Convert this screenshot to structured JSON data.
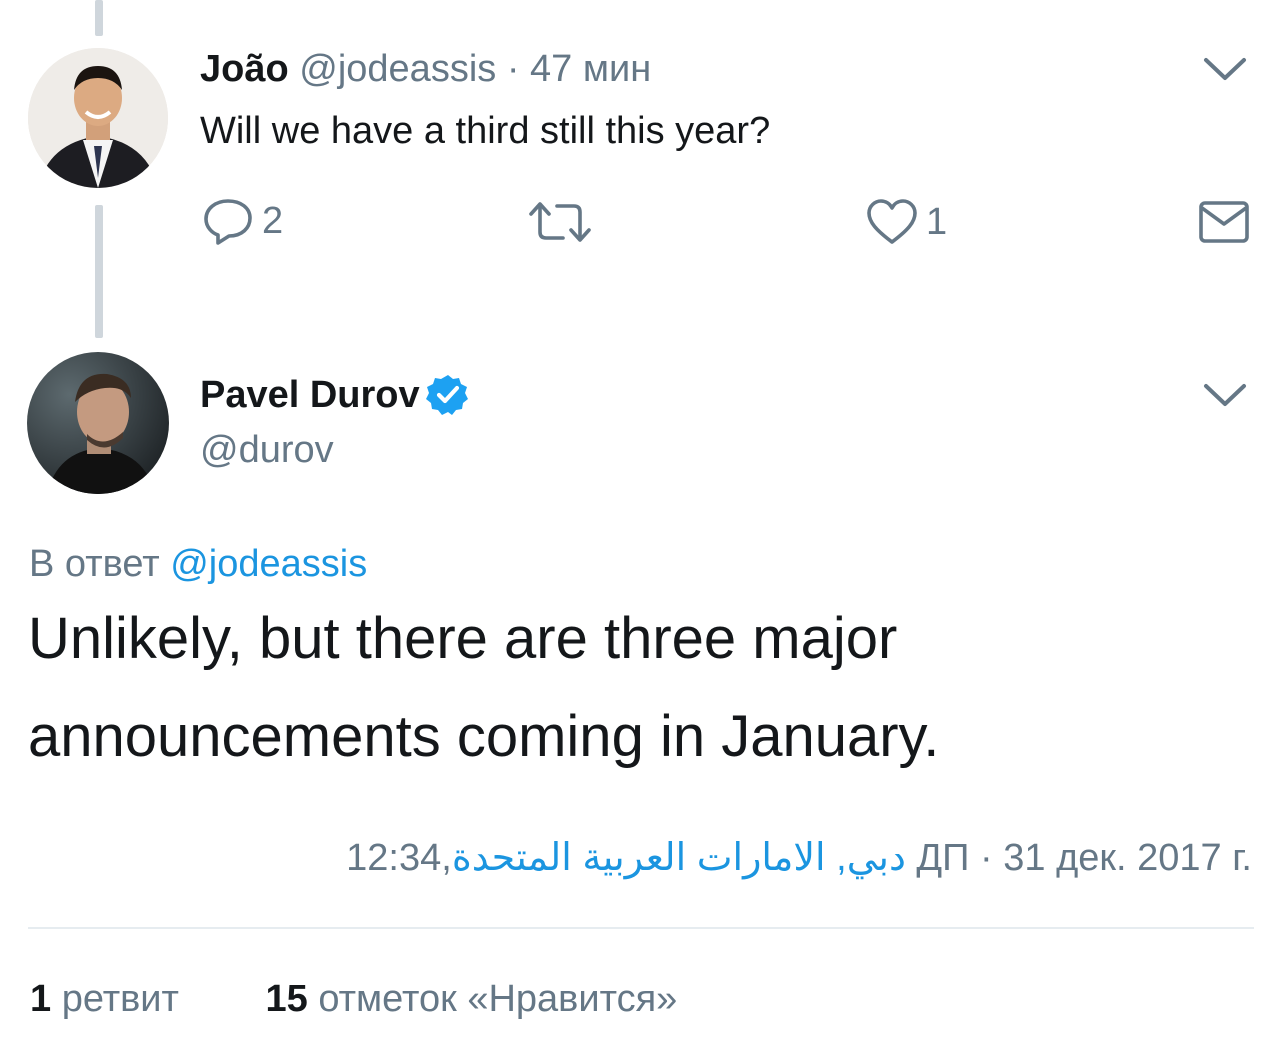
{
  "reply_tweet": {
    "author_name": "João",
    "handle": "@jodeassis",
    "separator": "·",
    "time": "47 мин",
    "text": "Will we have a third still this year?",
    "replies_count": "2",
    "likes_count": "1",
    "icons": [
      "chevron-down-icon",
      "reply-icon",
      "retweet-icon",
      "like-icon",
      "message-icon"
    ]
  },
  "main_tweet": {
    "author_name": "Pavel Durov",
    "verified": true,
    "handle": "@durov",
    "reply_to_prefix": "В ответ",
    "reply_to_handle": "@jodeassis",
    "text_line1": "Unlikely, but there are three major",
    "text_line2": "announcements coming in January.",
    "location": "دبي, الامارات العربية المتحدة",
    "timestamp": ",12:34 ДП · 31 дек. 2017 г.",
    "retweets_count": "1",
    "retweets_label": "ретвит",
    "likes_count": "15",
    "likes_label": "отметок «Нравится»"
  },
  "colors": {
    "link": "#1b95e0",
    "muted": "#657786",
    "verified": "#1da1f2",
    "thread_line": "#cfd6dc",
    "divider": "#e6ecf0"
  }
}
